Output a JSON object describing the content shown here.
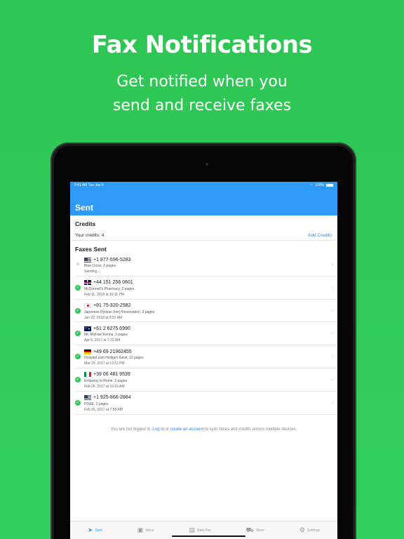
{
  "promo": {
    "headline": "Fax Notifications",
    "subline_1": "Get notified when you",
    "subline_2": "send and receive faxes"
  },
  "status_bar": {
    "time": "9:41 AM   Tue Jan 9",
    "battery": "100%"
  },
  "nav": {
    "title": "Sent"
  },
  "credits": {
    "title": "Credits",
    "text": "Your credits: 4",
    "add_label": "Add Credits"
  },
  "faxes": {
    "title": "Faxes Sent",
    "items": [
      {
        "flag": "us",
        "number": "+1 877-596-5283",
        "subtitle": "Blue Cross, 2 pages",
        "date": "Sending ...",
        "status": "pending"
      },
      {
        "flag": "gb",
        "number": "+44 151 256 0601",
        "subtitle": "McDonnell's Pharmacy, 2 pages",
        "date": "Feb 11, 2018 at 10:11 PM",
        "status": "sent"
      },
      {
        "flag": "jp",
        "number": "+81 75-320-2582",
        "subtitle": "Japanese Ryokan (Inn) Reservation, 3 pages",
        "date": "Jan 22, 2018 at 8:52 AM",
        "status": "sent"
      },
      {
        "flag": "au",
        "number": "+61 2 6275 6990",
        "subtitle": "Mr. Michael Kenna, 2 pages",
        "date": "Apr 6, 2017 at 7:22 AM",
        "status": "sent"
      },
      {
        "flag": "de",
        "number": "+49 69 21962455",
        "subtitle": "Hospital zum Heiligen Geist, 12 pages",
        "date": "Mar 20, 2017 at 12:11 PM",
        "status": "sent"
      },
      {
        "flag": "it",
        "number": "+39 06 481 9539",
        "subtitle": "Embassy in Rome, 2 pages",
        "date": "Feb 26, 2017 at 10:19 AM",
        "status": "sent"
      },
      {
        "flag": "us",
        "number": "+1 925-866-2864",
        "subtitle": "PG&E, 2 pages",
        "date": "Feb 15, 2017 at 7:58 AM",
        "status": "sent"
      }
    ]
  },
  "login_note": {
    "prefix": "You are not logged in.",
    "login": "Log in",
    "or": "or",
    "create": "create an account",
    "suffix": "to sync faxes and credits across multiple devices."
  },
  "tabs": [
    {
      "label": "Sent",
      "icon": "paper-plane-icon",
      "active": true
    },
    {
      "label": "Inbox",
      "icon": "inbox-icon",
      "active": false
    },
    {
      "label": "New Fax",
      "icon": "document-icon",
      "active": false
    },
    {
      "label": "Store",
      "icon": "cart-icon",
      "active": false
    },
    {
      "label": "Settings",
      "icon": "gear-icon",
      "active": false
    }
  ],
  "colors": {
    "background": "#2dc653",
    "accent": "#2e9bf6",
    "check": "#34c759",
    "link": "#2e86e8"
  }
}
